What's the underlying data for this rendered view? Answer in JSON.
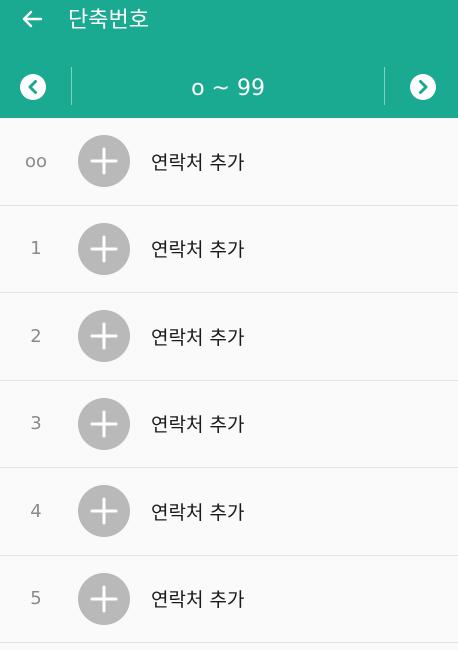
{
  "header": {
    "title": "단축번호",
    "back_icon": "arrow-left-icon",
    "bg_color": "#1aa991"
  },
  "pager": {
    "range_label": "o ~ 99",
    "prev_icon": "chevron-left-circle-icon",
    "next_icon": "chevron-right-circle-icon"
  },
  "list": {
    "rows": [
      {
        "number": "oo",
        "label": "연락처 추가"
      },
      {
        "number": "1",
        "label": "연락처 추가"
      },
      {
        "number": "2",
        "label": "연락처 추가"
      },
      {
        "number": "3",
        "label": "연락처 추가"
      },
      {
        "number": "4",
        "label": "연락처 추가"
      },
      {
        "number": "5",
        "label": "연락처 추가"
      }
    ],
    "add_icon": "plus-circle-icon"
  }
}
